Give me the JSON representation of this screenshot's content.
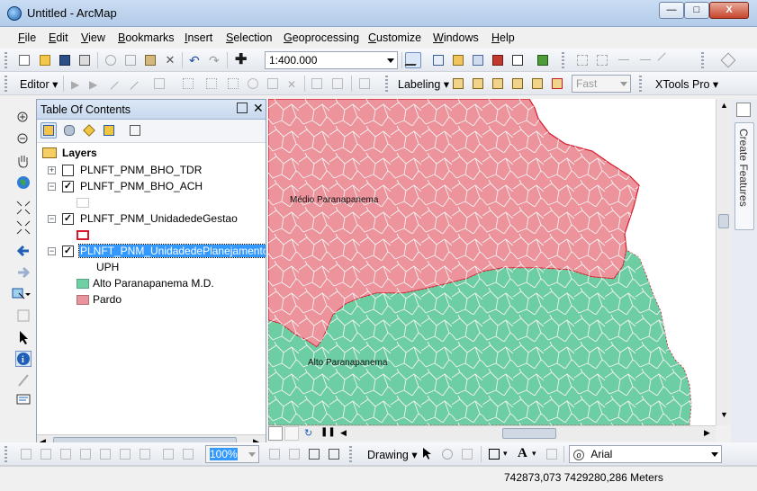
{
  "window": {
    "title": "Untitled - ArcMap",
    "minimize": "—",
    "maximize": "□",
    "close": "X"
  },
  "menu": [
    {
      "key": "F",
      "rest": "ile"
    },
    {
      "key": "E",
      "rest": "dit"
    },
    {
      "key": "V",
      "rest": "iew"
    },
    {
      "key": "B",
      "rest": "ookmarks"
    },
    {
      "key": "I",
      "rest": "nsert"
    },
    {
      "key": "S",
      "rest": "election"
    },
    {
      "key": "G",
      "rest": "eoprocessing"
    },
    {
      "key": "C",
      "rest": "ustomize"
    },
    {
      "key": "W",
      "rest": "indows"
    },
    {
      "key": "H",
      "rest": "elp"
    }
  ],
  "toolbar": {
    "scale": "1:400.000",
    "editor_label": "Editor",
    "labeling_label": "Labeling",
    "labeling_quality": "Fast",
    "xtools_label": "XTools Pro",
    "drawing_label": "Drawing",
    "zoom_percent": "100%",
    "font_name": "Arial"
  },
  "toc": {
    "title": "Table Of Contents",
    "root": "Layers",
    "layers": [
      {
        "name": "PLNFT_PNM_BHO_TDR",
        "checked": false,
        "expanded": false
      },
      {
        "name": "PLNFT_PNM_BHO_ACH",
        "checked": true,
        "expanded": true
      },
      {
        "name": "PLNFT_PNM_UnidadedeGestao",
        "checked": true,
        "expanded": true
      },
      {
        "name": "PLNFT_PNM_UnidadedePlanejamento",
        "checked": true,
        "expanded": true,
        "selected": true
      }
    ],
    "field": "UPH",
    "classes": [
      {
        "label": "Alto Paranapanema M.D.",
        "color": "#6fcfa5"
      },
      {
        "label": "Pardo",
        "color": "#e8949c"
      }
    ]
  },
  "map": {
    "labels": {
      "north": "Médio Paranapanema",
      "south": "Alto Paranapanema"
    },
    "colors": {
      "pardo": "#ec939c",
      "alto": "#6dcea3",
      "boundary": "#f2f2f2",
      "outline": "#d8182a"
    }
  },
  "dock": {
    "create_features": "Create Features"
  },
  "status": {
    "coordinates": "742873,073  7429280,286 Meters"
  }
}
